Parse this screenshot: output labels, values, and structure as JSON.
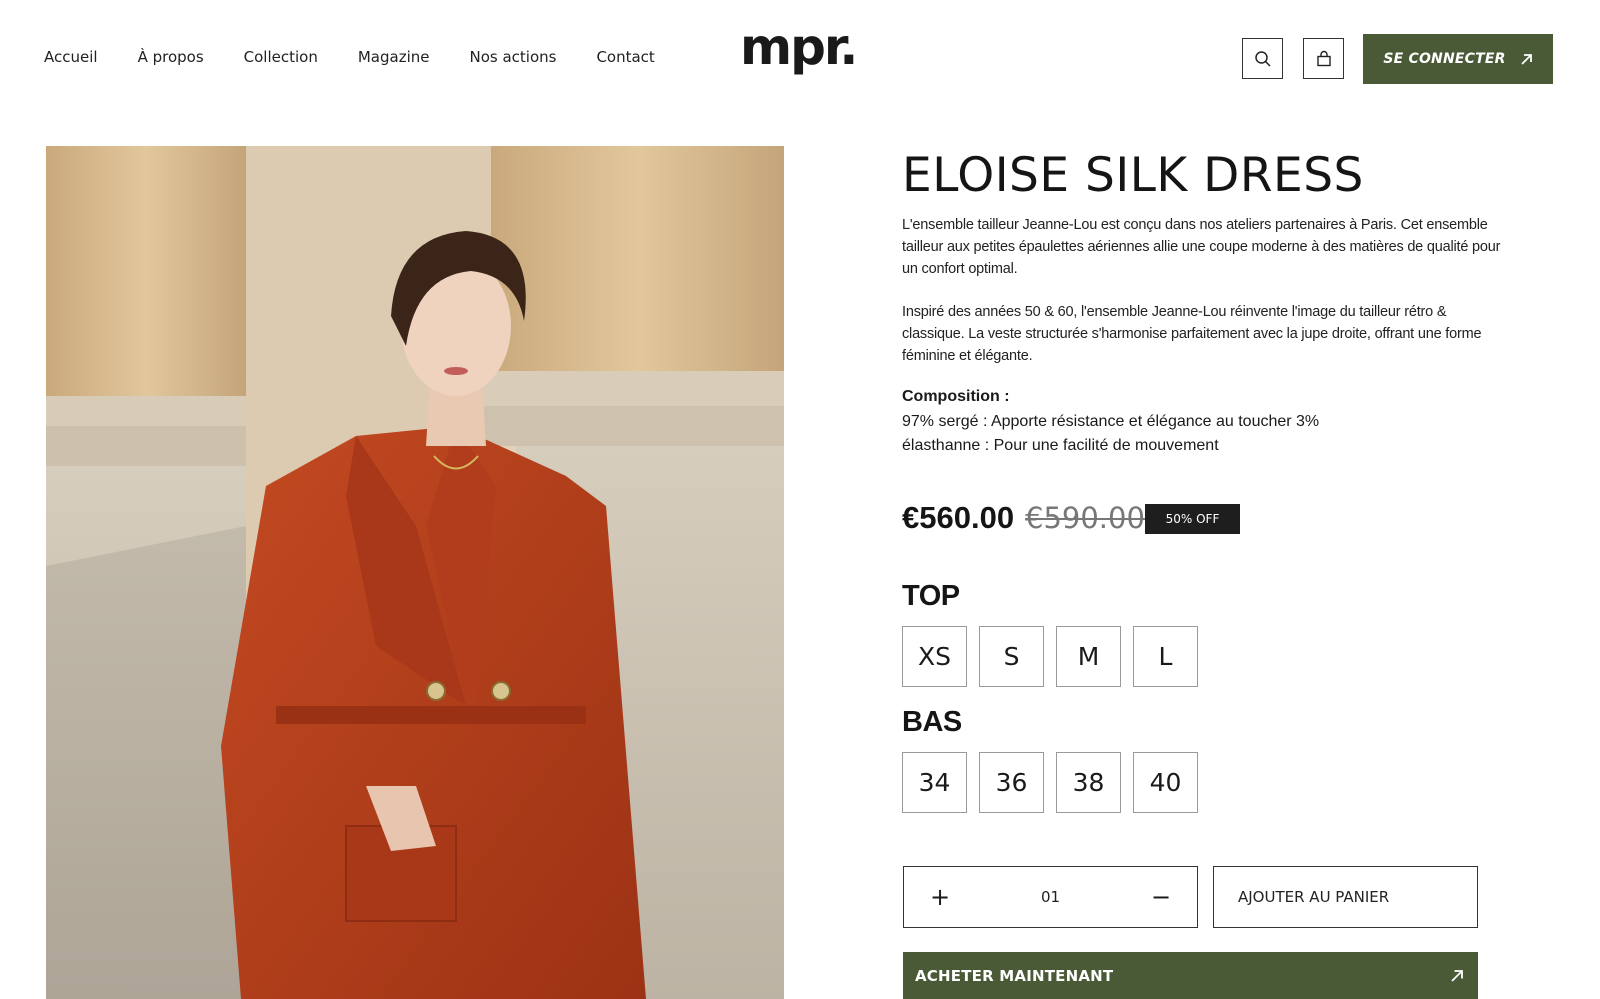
{
  "nav": {
    "items": [
      "Accueil",
      "À propos",
      "Collection",
      "Magazine",
      "Nos actions",
      "Contact"
    ]
  },
  "brand": {
    "logo": "mpr."
  },
  "header": {
    "search_icon": "search-icon",
    "cart_icon": "shopping-bag-icon",
    "login_label": "SE CONNECTER",
    "login_icon": "arrow-up-right-icon"
  },
  "product": {
    "title": "ELOISE SILK DRESS",
    "description_1": "L'ensemble tailleur Jeanne-Lou  est conçu dans nos ateliers partenaires à Paris. Cet ensemble tailleur aux petites épaulettes aériennes allie une coupe moderne à des matières de qualité pour un confort optimal.",
    "description_2": "Inspiré des années 50 & 60, l'ensemble Jeanne-Lou réinvente l'image du tailleur rétro & classique. La veste structurée s'harmonise parfaitement avec la jupe droite, offrant une forme féminine et élégante.",
    "composition_title": "Composition :",
    "composition_line_1": "97% sergé : Apporte résistance et élégance au toucher 3%",
    "composition_line_2": "élasthanne : Pour une facilité de mouvement",
    "price": "€560.00",
    "old_price": "€590.00",
    "discount_badge": "50% OFF",
    "top_label": "TOP",
    "top_sizes": [
      "XS",
      "S",
      "M",
      "L"
    ],
    "bottom_label": "BAS",
    "bottom_sizes": [
      "34",
      "36",
      "38",
      "40"
    ],
    "quantity": "01",
    "quantity_plus": "+",
    "quantity_minus": "−",
    "add_to_cart_label": "AJOUTER AU PANIER",
    "buy_now_label": "ACHETER MAINTENANT",
    "buy_now_icon": "arrow-up-right-icon"
  },
  "colors": {
    "accent_green": "#4a5a36",
    "badge_dark": "#1e1e1e",
    "dress_red": "#b8401c",
    "stone": "#d8c4a4"
  }
}
